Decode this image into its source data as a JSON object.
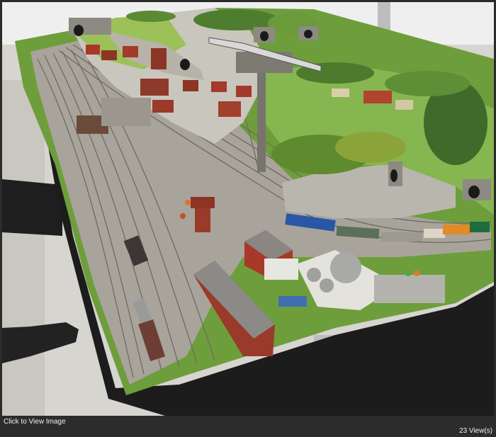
{
  "viewer": {
    "image_alt": "Model railway layout",
    "click_label": "Click to View Image",
    "views_count": "23",
    "views_label": "View(s)"
  },
  "colors": {
    "footer_bg": "#2c2c2c",
    "footer_text": "#f0f0f0",
    "floor": "#cfcfcf",
    "table_black": "#1f1f1f",
    "grass": "#7fb24a",
    "ballast": "#a9a49a",
    "rock": "#b9b6ad",
    "roof_red": "#9a3a2a"
  },
  "icons": [
    "train-icon",
    "tunnel-portal-icon",
    "water-tower-icon"
  ]
}
